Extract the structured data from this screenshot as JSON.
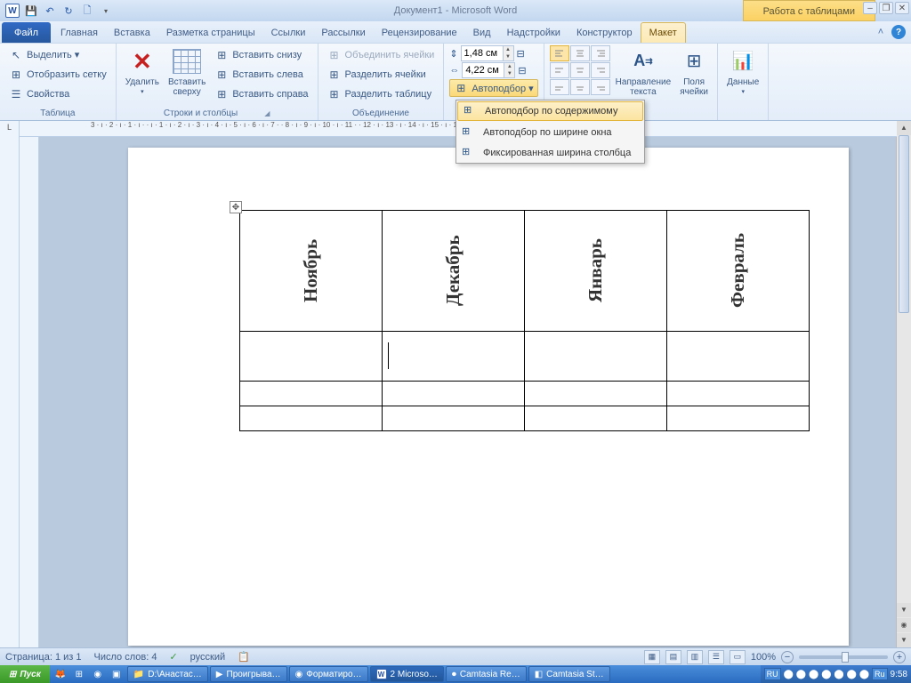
{
  "titlebar": {
    "title": "Документ1 - Microsoft Word",
    "context_tab": "Работа с таблицами"
  },
  "tabs": {
    "file": "Файл",
    "items": [
      "Главная",
      "Вставка",
      "Разметка страницы",
      "Ссылки",
      "Рассылки",
      "Рецензирование",
      "Вид",
      "Надстройки",
      "Конструктор"
    ],
    "active": "Макет"
  },
  "ribbon": {
    "table_group": {
      "label": "Таблица",
      "select": "Выделить ▾",
      "grid": "Отобразить сетку",
      "props": "Свойства"
    },
    "rows_cols": {
      "label": "Строки и столбцы",
      "delete": "Удалить",
      "insert_above": "Вставить\nсверху",
      "below": "Вставить снизу",
      "left": "Вставить слева",
      "right": "Вставить справа"
    },
    "merge": {
      "label": "Объединение",
      "merge_cells": "Объединить ячейки",
      "split_cells": "Разделить ячейки",
      "split_table": "Разделить таблицу"
    },
    "size": {
      "height": "1,48 см",
      "width": "4,22 см",
      "autofit": "Автоподбор ▾"
    },
    "align": {
      "dir": "Направление\nтекста",
      "margins": "Поля\nячейки",
      "label": "вание"
    },
    "data": {
      "label": "Данные"
    }
  },
  "dropdown": {
    "items": [
      "Автоподбор по содержимому",
      "Автоподбор по ширине окна",
      "Фиксированная ширина столбца"
    ]
  },
  "ruler_marks": "3 · ı · 2 · ı · 1 · ı ·  · ı · 1 · ı · 2 · ı · 3 · ı · 4 · ı · 5 · ı · 6 · ı · 7 ·  · 8 · ı · 9 · ı · 10 · ı · 11 ·  · 12 · ı · 13 · ı · 14 · ı · 15 · ı · 16 ·  · 17 · ı · 18",
  "doc": {
    "headers": [
      "Ноябрь",
      "Декабрь",
      "Январь",
      "Февраль"
    ]
  },
  "status": {
    "page": "Страница: 1 из 1",
    "words": "Число слов: 4",
    "lang": "русский",
    "zoom": "100%"
  },
  "taskbar": {
    "start": "Пуск",
    "items": [
      "D:\\Анастас…",
      "Проигрыва…",
      "Форматиро…",
      "2 Microso…",
      "Camtasia Re…",
      "Camtasia St…"
    ],
    "lang": "Ru",
    "time": "9:58",
    "tray_lang2": "RU"
  }
}
